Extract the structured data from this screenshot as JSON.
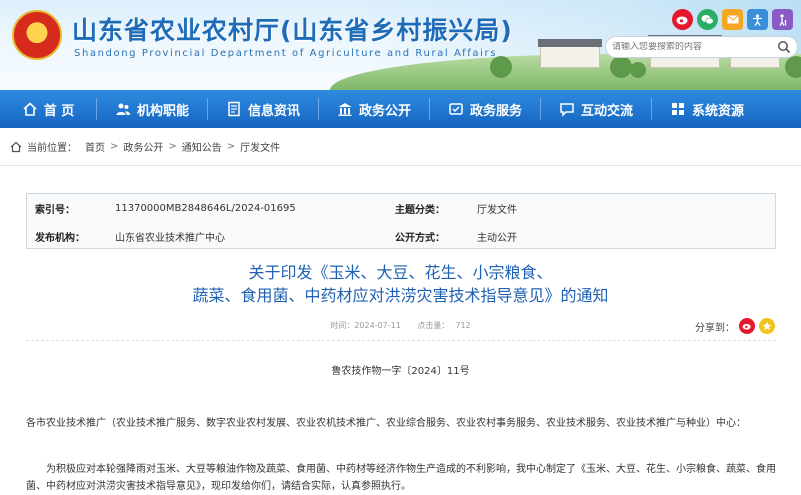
{
  "header": {
    "site_title": "山东省农业农村厅(山东省乡村振兴局)",
    "site_subtitle": "Shandong Provincial Department of Agriculture and Rural Affairs",
    "search_placeholder": "请输入您要搜索的内容",
    "social_icons": [
      "weibo-icon",
      "wechat-icon",
      "mail-icon",
      "accessibility-icon",
      "elderly-icon"
    ]
  },
  "nav": {
    "items": [
      {
        "label": "首 页",
        "icon": "home-icon"
      },
      {
        "label": "机构职能",
        "icon": "people-icon"
      },
      {
        "label": "信息资讯",
        "icon": "document-icon"
      },
      {
        "label": "政务公开",
        "icon": "building-icon"
      },
      {
        "label": "政务服务",
        "icon": "service-icon"
      },
      {
        "label": "互动交流",
        "icon": "chat-icon"
      },
      {
        "label": "系统资源",
        "icon": "resource-icon"
      }
    ]
  },
  "breadcrumb": {
    "prefix": "当前位置：",
    "items": [
      "首页",
      "政务公开",
      "通知公告",
      "厅发文件"
    ]
  },
  "meta": {
    "index_label": "索引号：",
    "index_value": "11370000MB2848646L/2024-01695",
    "category_label": "主题分类：",
    "category_value": "厅发文件",
    "issuer_label": "发布机构：",
    "issuer_value": "山东省农业技术推广中心",
    "open_label": "公开方式：",
    "open_value": "主动公开"
  },
  "article": {
    "title_line1": "关于印发《玉米、大豆、花生、小宗粮食、",
    "title_line2": "蔬菜、食用菌、中药材应对洪涝灾害技术指导意见》的通知",
    "time_label": "时间：",
    "time_value": "2024-07-11",
    "hits_label": "点击量：",
    "hits_value": "712",
    "share_label": "分享到：",
    "doc_number": "鲁农技作物一字〔2024〕11号",
    "para1": "各市农业技术推广（农业技术推广服务、数字农业农村发展、农业农机技术推广、农业综合服务、农业农村事务服务、农业技术服务、农业技术推广与种业）中心：",
    "para2": "为积极应对本轮强降雨对玉米、大豆等粮油作物及蔬菜、食用菌、中药材等经济作物生产造成的不利影响，我中心制定了《玉米、大豆、花生、小宗粮食、蔬菜、食用菌、中药材应对洪涝灾害技术指导意见》，现印发给你们，请结合实际，认真参照执行。"
  },
  "colors": {
    "nav": "#1565c0",
    "title": "#1f60b3",
    "brand": "#1e6bb8"
  }
}
